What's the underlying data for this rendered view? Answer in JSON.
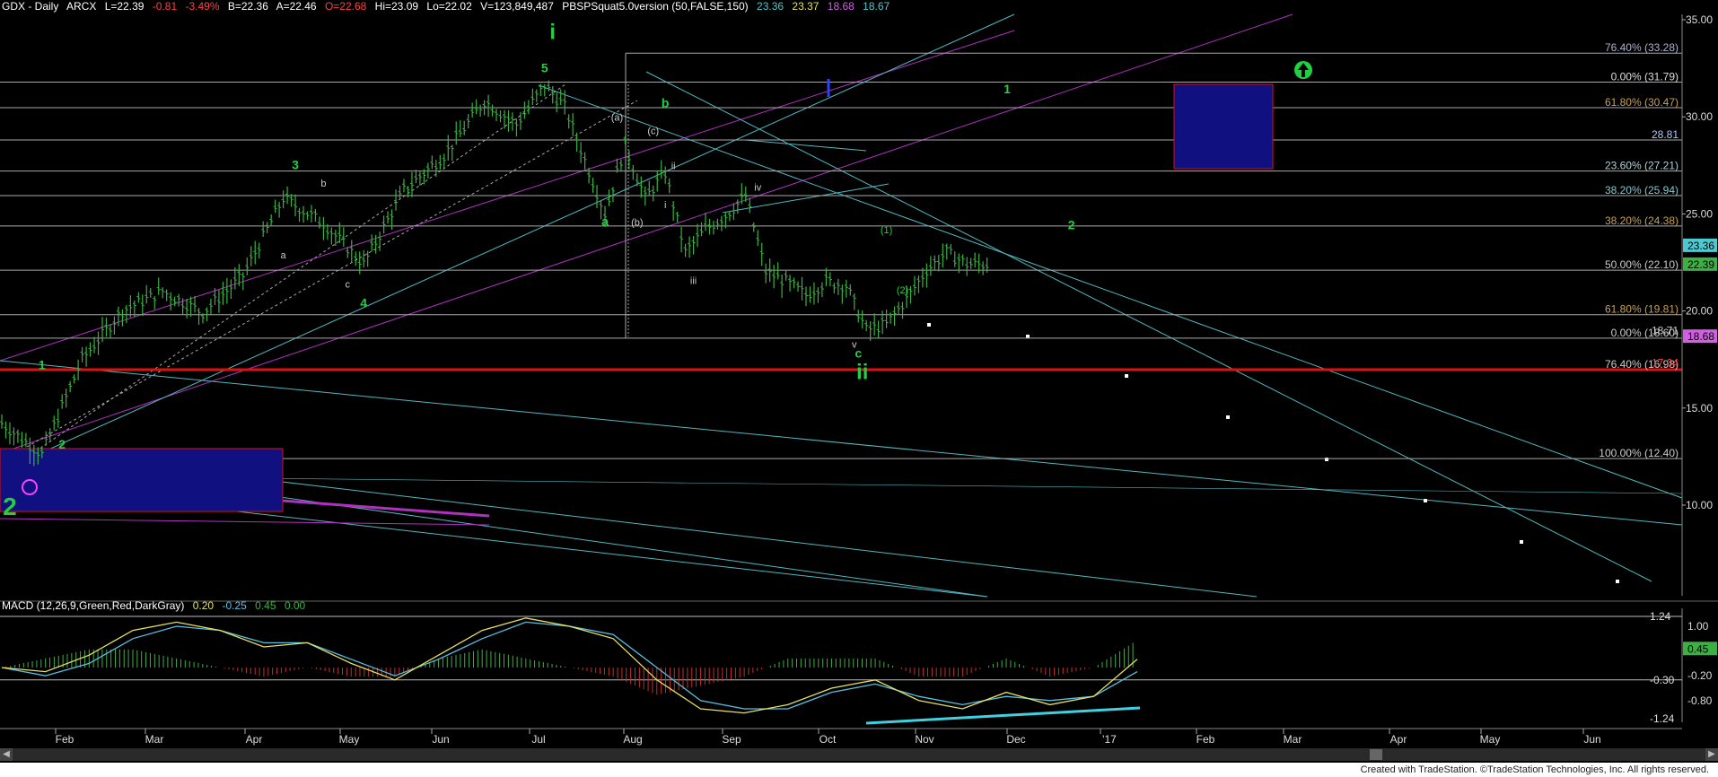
{
  "header": {
    "symbol": "GDX - Daily",
    "exchange": "ARCX",
    "last": "L=22.39",
    "change": "-0.81",
    "pct": "-3.49%",
    "bid": "B=22.36",
    "ask": "A=22.46",
    "open": "O=22.68",
    "high": "Hi=23.09",
    "low": "Lo=22.02",
    "volume": "V=123,849,487",
    "study": "PBSPSquat5.0version (50,FALSE,150)",
    "v1": "23.36",
    "v2": "23.37",
    "v3": "18.68",
    "v4": "18.67"
  },
  "macd_header": {
    "name": "MACD (12,26,9,Green,Red,DarkGray)",
    "v1": "0.20",
    "v2": "-0.25",
    "v3": "0.45",
    "v4": "0.00"
  },
  "colors": {
    "background": "#000000",
    "bar_up": "#3cb043",
    "cyan_line": "#4fb8c0",
    "magenta_line": "#b030c0",
    "red_line": "#e01010",
    "fib_gray": "#b0b0b0",
    "fib_label_gold": "#c8a050",
    "wave_green": "#22d040",
    "blue_box": "#101080",
    "macd_up": "#3cb043",
    "macd_down": "#c03030",
    "macd_line": "#e8e060",
    "signal_line": "#58c0e0"
  },
  "credit": "Created with TradeStation. ©TradeStation Technologies, Inc. All rights reserved.",
  "chart_data": {
    "type": "candlestick",
    "symbol": "GDX",
    "timeframe": "Daily",
    "x_tick_labels": [
      "Feb",
      "Mar",
      "Apr",
      "May",
      "Jun",
      "Jul",
      "Aug",
      "Sep",
      "Oct",
      "Nov",
      "Dec",
      "'17",
      "Feb",
      "Mar",
      "Apr",
      "May",
      "Jun"
    ],
    "price_axis": {
      "ticks": [
        10.0,
        15.0,
        20.0,
        25.0,
        30.0,
        35.0
      ],
      "tick_labels": [
        "10.00",
        "15.00",
        "20.00",
        "25.00",
        "30.00",
        "35.00"
      ],
      "last_price_labels": [
        "23.36",
        "22.39",
        "18.68"
      ]
    },
    "price_path": {
      "x_index": [
        0,
        10,
        20,
        30,
        40,
        50,
        60,
        70,
        80,
        90,
        100,
        110,
        120,
        128,
        135,
        140,
        150,
        155,
        160,
        165,
        170,
        175,
        180,
        185,
        190,
        195,
        200,
        205,
        210,
        215,
        220,
        225,
        230,
        235,
        240,
        245
      ],
      "close": [
        14.2,
        12.6,
        17.5,
        20.0,
        21.0,
        19.9,
        21.8,
        25.8,
        24.5,
        22.4,
        26.2,
        28.0,
        30.8,
        29.6,
        31.6,
        30.5,
        25.0,
        28.5,
        25.8,
        27.1,
        23.0,
        24.2,
        24.9,
        25.9,
        22.0,
        21.5,
        20.8,
        21.5,
        21.3,
        19.0,
        19.3,
        20.6,
        22.1,
        23.0,
        22.4,
        22.39
      ]
    },
    "fib_levels": [
      {
        "label": "76.40% (33.28)",
        "price": 33.28
      },
      {
        "label": "0.00% (31.79)",
        "price": 31.79
      },
      {
        "label": "61.80% (30.47)",
        "price": 30.47
      },
      {
        "label": "28.81",
        "price": 28.81
      },
      {
        "label": "23.60% (27.21)",
        "price": 27.21
      },
      {
        "label": "38.20% (25.94)",
        "price": 25.94
      },
      {
        "label": "38.20% (24.38)",
        "price": 24.38
      },
      {
        "label": "50.00% (22.10)",
        "price": 22.1
      },
      {
        "label": "61.80% (19.81)",
        "price": 19.81
      },
      {
        "label": "0.00% (18.60)",
        "price": 18.6
      },
      {
        "label": "18.71",
        "price": 18.71
      },
      {
        "label": "76.40% (16.98)",
        "price": 16.98
      },
      {
        "label": "17.04",
        "price": 17.04
      },
      {
        "label": "100.00% (12.40)",
        "price": 12.4
      }
    ],
    "wave_labels": [
      {
        "text": "1",
        "price": 17.0,
        "x_index": 10
      },
      {
        "text": "2",
        "price": 12.9,
        "x_index": 15
      },
      {
        "text": "2",
        "price": 9.5,
        "x_index": 2
      },
      {
        "text": "3",
        "price": 27.3,
        "x_index": 73
      },
      {
        "text": "4",
        "price": 20.2,
        "x_index": 90
      },
      {
        "text": "5",
        "price": 32.3,
        "x_index": 135
      },
      {
        "text": "i",
        "price": 34.0,
        "x_index": 137
      },
      {
        "text": "a",
        "price": 24.4,
        "x_index": 150
      },
      {
        "text": "b",
        "price": 30.5,
        "x_index": 165
      },
      {
        "text": "c",
        "price": 17.6,
        "x_index": 213
      },
      {
        "text": "ii",
        "price": 16.5,
        "x_index": 214
      },
      {
        "text": "1",
        "price": 31.2,
        "x_index": 250
      },
      {
        "text": "2",
        "price": 24.2,
        "x_index": 266
      },
      {
        "text": "(1)",
        "price": 24.0,
        "x_index": 220
      },
      {
        "text": "(2)",
        "price": 20.9,
        "x_index": 224
      },
      {
        "text": "(a)",
        "price": 29.8,
        "x_index": 153
      },
      {
        "text": "(b)",
        "price": 24.4,
        "x_index": 158
      },
      {
        "text": "(c)",
        "price": 29.1,
        "x_index": 162
      },
      {
        "text": "ii",
        "price": 27.3,
        "x_index": 167
      },
      {
        "text": "i",
        "price": 25.3,
        "x_index": 165
      },
      {
        "text": "iii",
        "price": 21.4,
        "x_index": 172
      },
      {
        "text": "iv",
        "price": 26.2,
        "x_index": 188
      },
      {
        "text": "v",
        "price": 18.1,
        "x_index": 212
      },
      {
        "text": "a",
        "price": 22.7,
        "x_index": 70
      },
      {
        "text": "b",
        "price": 26.4,
        "x_index": 80
      },
      {
        "text": "c",
        "price": 21.2,
        "x_index": 86
      }
    ],
    "macd": {
      "y_tick_labels": [
        "1.24",
        "1.00",
        "0.45",
        "-0.30",
        "-0.20",
        "-0.80",
        "-1.24"
      ],
      "macd_line": [
        0.0,
        -0.1,
        0.3,
        0.9,
        1.1,
        0.9,
        0.5,
        0.6,
        0.1,
        -0.3,
        0.3,
        0.9,
        1.2,
        1.0,
        0.7,
        -0.3,
        -1.0,
        -1.1,
        -0.9,
        -0.5,
        -0.3,
        -0.8,
        -1.0,
        -0.6,
        -0.9,
        -0.7,
        0.2
      ],
      "signal_line": [
        0.0,
        -0.2,
        0.1,
        0.7,
        1.0,
        0.9,
        0.6,
        0.6,
        0.2,
        -0.2,
        0.2,
        0.7,
        1.1,
        1.0,
        0.8,
        0.0,
        -0.8,
        -1.0,
        -1.0,
        -0.6,
        -0.4,
        -0.7,
        -0.9,
        -0.7,
        -0.8,
        -0.7,
        -0.1
      ]
    }
  }
}
